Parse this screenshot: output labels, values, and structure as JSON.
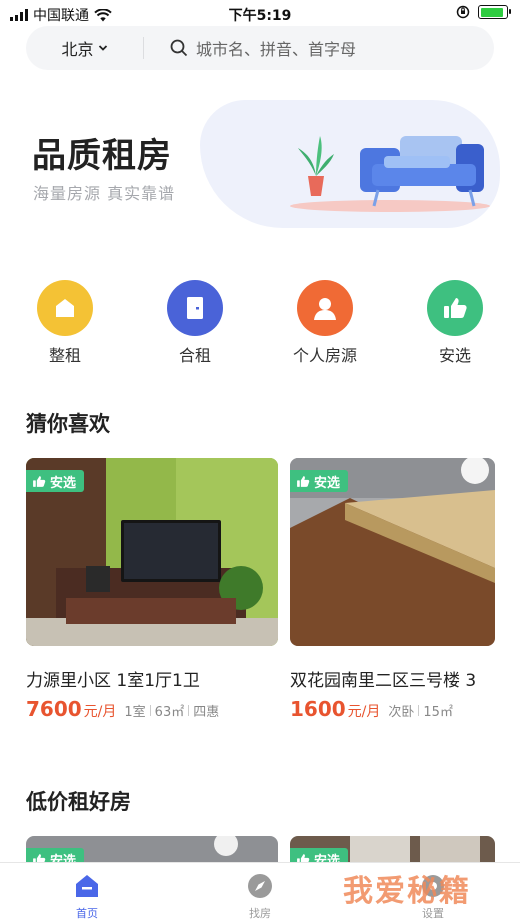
{
  "status_bar": {
    "carrier": "中国联通",
    "time": "下午5:19",
    "battery_level": 0.9,
    "colors": {
      "battery": "#2ecc40"
    }
  },
  "search": {
    "city": "北京",
    "placeholder": "城市名、拼音、首字母"
  },
  "hero": {
    "title": "品质租房",
    "subtitle": "海量房源 真实靠谱"
  },
  "categories": [
    {
      "label": "整租",
      "icon": "house-icon",
      "color": "#f4c235"
    },
    {
      "label": "合租",
      "icon": "door-icon",
      "color": "#4a63d8"
    },
    {
      "label": "个人房源",
      "icon": "person-icon",
      "color": "#f06a35"
    },
    {
      "label": "安选",
      "icon": "thumbs-up-icon",
      "color": "#3ec080"
    }
  ],
  "guess": {
    "title": "猜你喜欢",
    "listings": [
      {
        "tag": "安选",
        "name": "力源里小区 1室1厅1卫",
        "price": "7600",
        "unit": "元/月",
        "details": [
          "1室",
          "63㎡",
          "四惠"
        ]
      },
      {
        "tag": "安选",
        "name": "双花园南里二区三号楼 3",
        "price": "1600",
        "unit": "元/月",
        "details": [
          "次卧",
          "15㎡"
        ]
      }
    ]
  },
  "low_price": {
    "title": "低价租好房",
    "listings": [
      {
        "tag": "安选"
      },
      {
        "tag": "安选"
      }
    ]
  },
  "tabbar": {
    "items": [
      {
        "label": "首页",
        "icon": "home-icon",
        "active": true
      },
      {
        "label": "找房",
        "icon": "compass-icon",
        "active": false
      },
      {
        "label": "设置",
        "icon": "settings-icon",
        "active": false
      }
    ],
    "colors": {
      "active": "#4a67e8",
      "inactive": "#9a9a9a"
    }
  },
  "watermark": "我爱秘籍",
  "colors": {
    "accent": "#e8542f",
    "tag": "#3ec080"
  }
}
